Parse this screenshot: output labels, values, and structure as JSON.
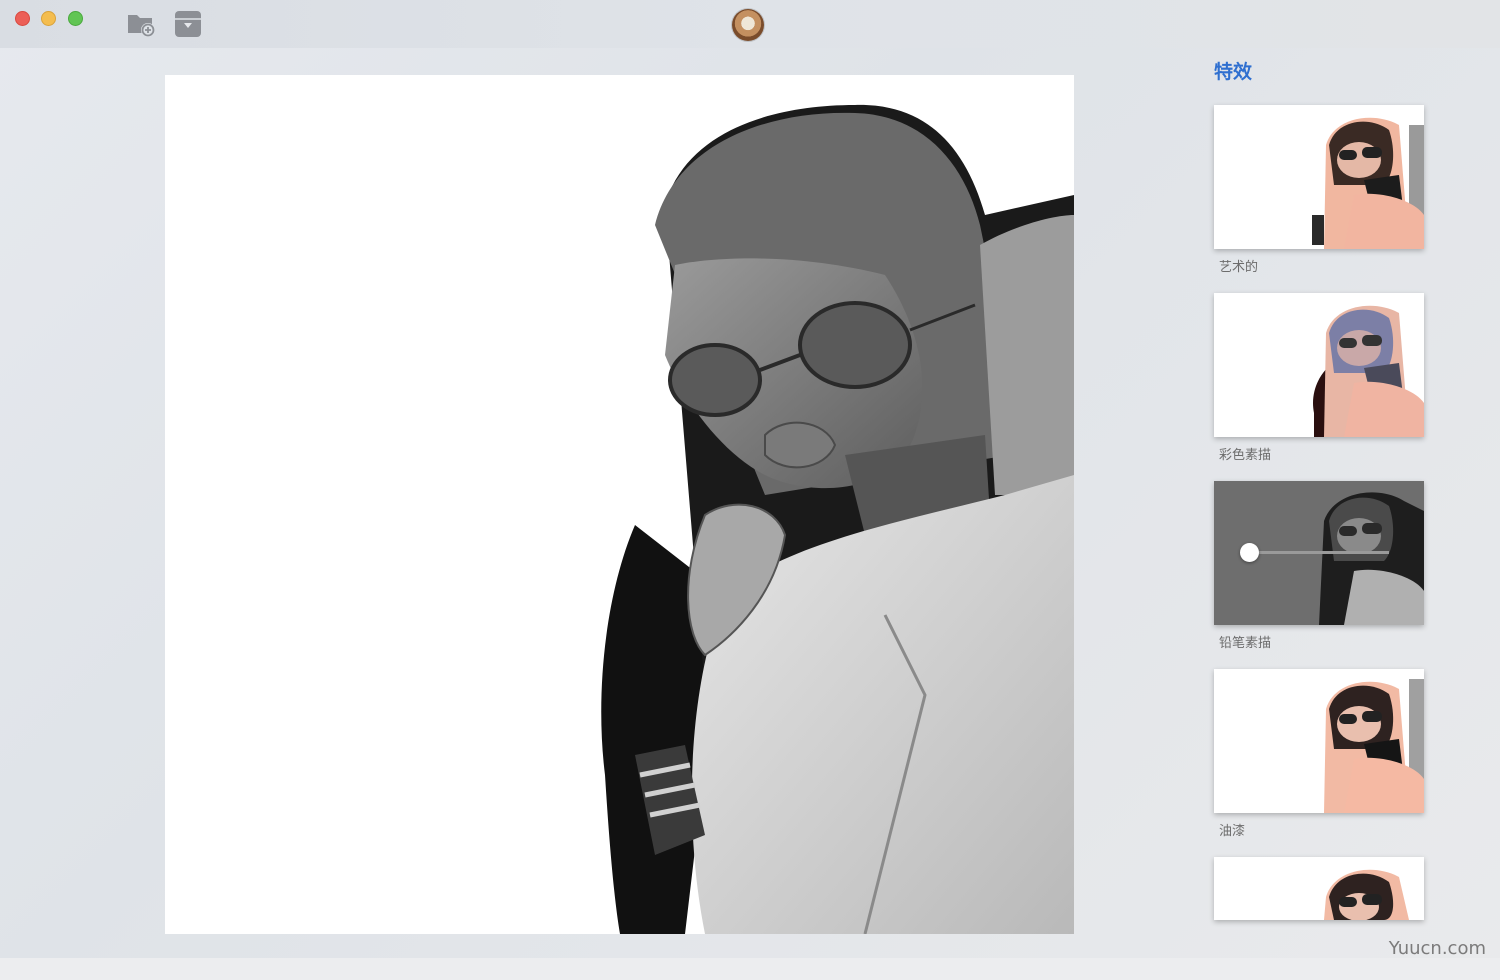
{
  "window": {
    "buttons": [
      "close",
      "minimize",
      "maximize"
    ]
  },
  "toolbar": {
    "open_icon": "folder-add-icon",
    "save_icon": "save-down-icon",
    "avatar": "lion-avatar"
  },
  "sidebar": {
    "title": "特效",
    "effects": [
      {
        "label": "艺术的",
        "style": "color"
      },
      {
        "label": "彩色素描",
        "style": "color"
      },
      {
        "label": "铅笔素描",
        "style": "gray",
        "selected": true,
        "slider_value": 0.15
      },
      {
        "label": "油漆",
        "style": "color"
      },
      {
        "label": "",
        "style": "color"
      }
    ]
  },
  "footer": {
    "watermark": "Yuucn.com"
  },
  "colors": {
    "accent": "#2f6fd0",
    "selected_thumb_bg": "#6e6e6e"
  }
}
